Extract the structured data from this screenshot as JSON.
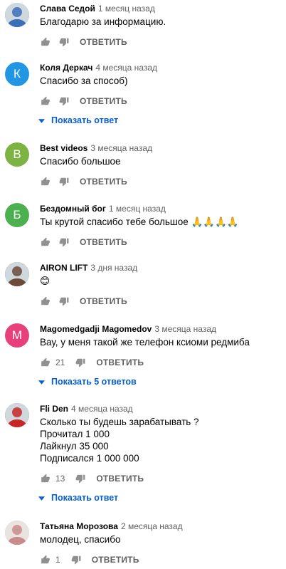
{
  "labels": {
    "reply": "ОТВЕТИТЬ"
  },
  "comments": [
    {
      "author": "Слава Седой",
      "time": "1 месяц назад",
      "lines": [
        "Благодарю за информацию."
      ],
      "avatar": {
        "type": "photo",
        "color": "#3b6fb8"
      }
    },
    {
      "author": "Коля Деркач",
      "time": "4 месяца назад",
      "lines": [
        "Спасибо за способ)"
      ],
      "avatar": {
        "type": "letter",
        "letter": "К",
        "color": "#2196e3"
      },
      "show_replies": "Показать ответ"
    },
    {
      "author": "Best videos",
      "time": "3 месяца назад",
      "lines": [
        "Спасибо большое"
      ],
      "avatar": {
        "type": "letter",
        "letter": "B",
        "color": "#7cb342"
      }
    },
    {
      "author": "Бездомный бог",
      "time": "1 месяц назад",
      "lines": [
        "Ты крутой спасибо тебе большое 🙏🙏🙏🙏"
      ],
      "avatar": {
        "type": "letter",
        "letter": "Б",
        "color": "#4caf50"
      }
    },
    {
      "author": "AIRON LIFT",
      "time": "3 дня назад",
      "lines": [
        "😊"
      ],
      "avatar": {
        "type": "photo",
        "color": "#6b4a3a"
      }
    },
    {
      "author": "Magomedgadji Magomedov",
      "time": "3 месяца назад",
      "lines": [
        "Вау, у меня такой же телефон ксиоми редмиба"
      ],
      "avatar": {
        "type": "letter",
        "letter": "M",
        "color": "#e8407a"
      },
      "likes": "21",
      "show_replies": "Показать 5 ответов"
    },
    {
      "author": "Fli Den",
      "time": "4 месяца назад",
      "lines": [
        "Сколько ты будешь зарабатывать ?",
        "Прочитал 1 000",
        "Лайкнул 35 000",
        "Подписался 1 000 000"
      ],
      "avatar": {
        "type": "photo",
        "color": "#c62828"
      },
      "likes": "13",
      "show_replies": "Показать ответ"
    },
    {
      "author": "Татьяна Морозова",
      "time": "2 месяца назад",
      "lines": [
        "молодец, спасибо"
      ],
      "avatar": {
        "type": "photo",
        "color": "#c98b8b"
      },
      "likes": "1"
    }
  ]
}
